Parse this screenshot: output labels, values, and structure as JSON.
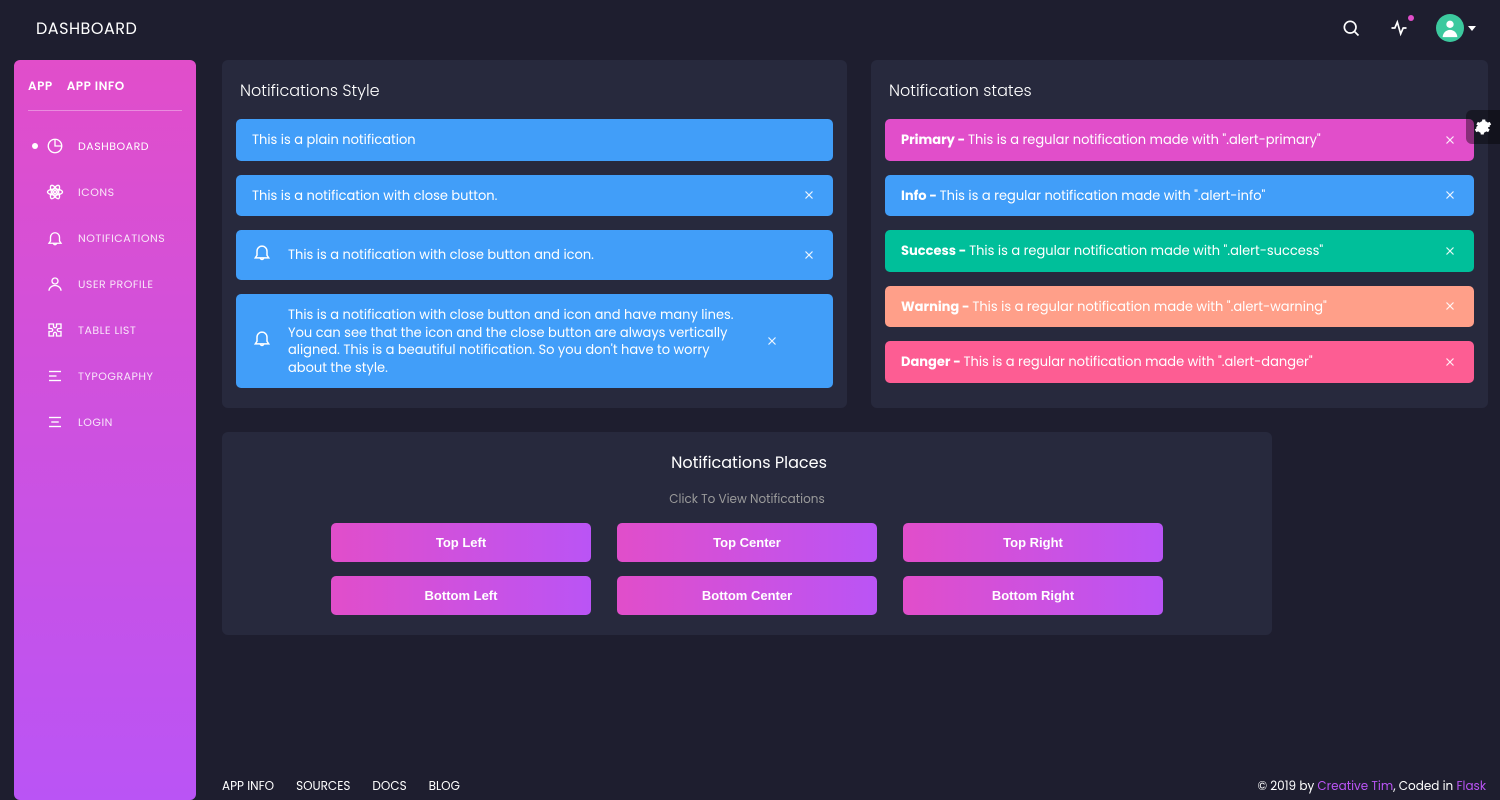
{
  "navbar": {
    "brand": "DASHBOARD"
  },
  "sidebar": {
    "header_left": "APP",
    "header_right": "APP INFO",
    "items": [
      {
        "label": "DASHBOARD"
      },
      {
        "label": "ICONS"
      },
      {
        "label": "NOTIFICATIONS"
      },
      {
        "label": "USER PROFILE"
      },
      {
        "label": "TABLE LIST"
      },
      {
        "label": "TYPOGRAPHY"
      },
      {
        "label": "LOGIN"
      }
    ]
  },
  "style_card": {
    "title": "Notifications Style",
    "plain": "This is a plain notification",
    "with_close": "This is a notification with close button.",
    "with_icon": "This is a notification with close button and icon.",
    "multiline": "This is a notification with close button and icon and have many lines. You can see that the icon and the close button are always vertically aligned. This is a beautiful notification. So you don't have to worry about the style."
  },
  "states_card": {
    "title": "Notification states",
    "items": [
      {
        "label": "Primary - ",
        "text": "This is a regular notification made with \".alert-primary\""
      },
      {
        "label": "Info - ",
        "text": "This is a regular notification made with \".alert-info\""
      },
      {
        "label": "Success - ",
        "text": "This is a regular notification made with \".alert-success\""
      },
      {
        "label": "Warning - ",
        "text": "This is a regular notification made with \".alert-warning\""
      },
      {
        "label": "Danger - ",
        "text": "This is a regular notification made with \".alert-danger\""
      }
    ]
  },
  "places_card": {
    "title": "Notifications Places",
    "subtitle": "Click To View Notifications",
    "buttons": [
      "Top Left",
      "Top Center",
      "Top Right",
      "Bottom Left",
      "Bottom Center",
      "Bottom Right"
    ]
  },
  "footer": {
    "links": [
      "APP INFO",
      "SOURCES",
      "DOCS",
      "BLOG"
    ],
    "copyright_prefix": "© 2019 by ",
    "creative": "Creative Tim",
    "middle": ", Coded in ",
    "flask": "Flask"
  }
}
